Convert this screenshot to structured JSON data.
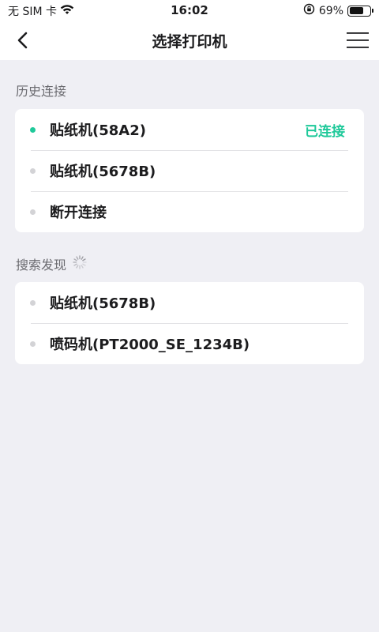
{
  "status_bar": {
    "carrier": "无 SIM 卡",
    "time": "16:02",
    "battery_percent_label": "69%",
    "battery_level": 0.69
  },
  "nav": {
    "title": "选择打印机",
    "back_icon": "chevron-left-icon",
    "menu_icon": "hamburger-menu-icon"
  },
  "history": {
    "title": "历史连接",
    "items": [
      {
        "label": "贴纸机(58A2)",
        "status": "已连接",
        "active": true
      },
      {
        "label": "贴纸机(5678B)",
        "status": "",
        "active": false
      },
      {
        "label": "断开连接",
        "status": "",
        "active": false
      }
    ]
  },
  "search": {
    "title": "搜索发现",
    "spinner_icon": "loading-spinner-icon",
    "items": [
      {
        "label": "贴纸机(5678B)"
      },
      {
        "label": "喷码机(PT2000_SE_1234B)"
      }
    ]
  },
  "colors": {
    "accent": "#1fc99a",
    "background": "#efeff4",
    "card": "#ffffff",
    "dot_inactive": "#d3d3d6"
  }
}
